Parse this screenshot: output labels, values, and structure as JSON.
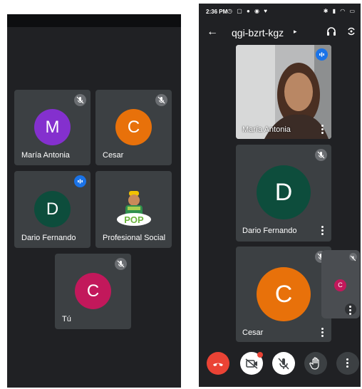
{
  "left_screen": {
    "tiles": [
      {
        "name": "María Antonia",
        "initial": "M",
        "color": "#8430ce",
        "state": "muted"
      },
      {
        "name": "Cesar",
        "initial": "C",
        "color": "#e8710a",
        "state": "muted"
      },
      {
        "name": "Dario Fernando",
        "initial": "D",
        "color": "#0d4d3c",
        "state": "speaking"
      },
      {
        "name": "Profesional Social",
        "image": "worker-logo",
        "logo_text": "POP",
        "state": "none"
      },
      {
        "name": "Tú",
        "initial": "C",
        "color": "#c2185b",
        "state": "muted"
      }
    ]
  },
  "right_screen": {
    "status_bar": {
      "time": "2:36 PM",
      "icons": [
        "clock-icon",
        "screenshot-icon",
        "whatsapp-icon",
        "messenger-icon",
        "heart-icon"
      ],
      "right_icons": [
        "bluetooth-icon",
        "signal-icon",
        "wifi-icon",
        "battery-icon"
      ]
    },
    "header": {
      "meeting_code": "qgi-bzrt-kgz",
      "back_icon": "back-arrow-icon",
      "audio_icon": "headphones-icon",
      "switch_icon": "switch-camera-icon"
    },
    "tiles": [
      {
        "name": "María Antonia",
        "type": "video",
        "state": "speaking"
      },
      {
        "name": "Dario Fernando",
        "initial": "D",
        "color": "#0d4d3c",
        "state": "muted"
      },
      {
        "name": "Cesar",
        "initial": "C",
        "color": "#e8710a",
        "state": "muted"
      }
    ],
    "self_view": {
      "initial": "C",
      "color": "#c2185b",
      "state": "muted"
    },
    "toolbar": [
      "end-call-button",
      "camera-off-button",
      "mic-off-button",
      "raise-hand-button",
      "more-options-button"
    ]
  },
  "colors": {
    "background": "#202124",
    "tile": "#3c4043",
    "end_call": "#ea4335",
    "speaking": "#1a73e8"
  }
}
